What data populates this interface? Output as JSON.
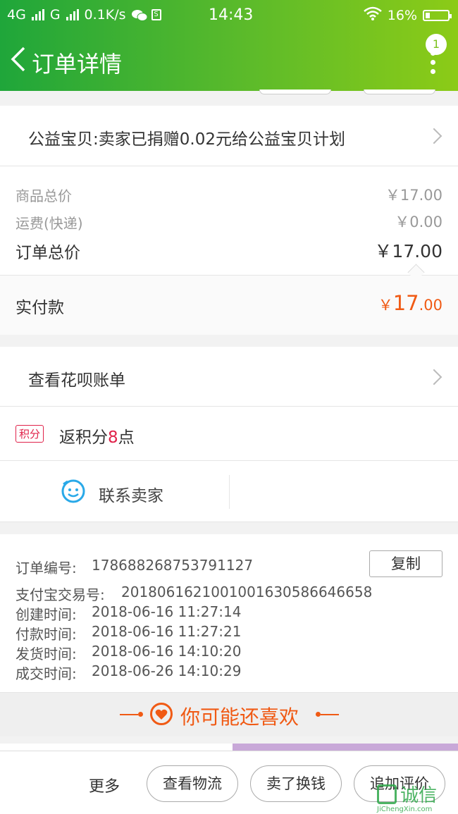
{
  "status_bar": {
    "network1": "4G",
    "network2": "G",
    "speed": "0.1K/s",
    "time": "14:43",
    "battery": "16%"
  },
  "nav": {
    "title": "订单详情",
    "badge": "1"
  },
  "charity": {
    "text": "公益宝贝:卖家已捐赠0.02元给公益宝贝计划"
  },
  "prices": {
    "goods_label": "商品总价",
    "goods_value": "￥17.00",
    "shipping_label": "运费(快递)",
    "shipping_value": "￥0.00",
    "total_label": "订单总价",
    "total_value": "￥17.00",
    "paid_label": "实付款",
    "paid_symbol": "￥",
    "paid_int": "17",
    "paid_dec": ".00"
  },
  "huabei": {
    "text": "查看花呗账单"
  },
  "points": {
    "tag": "积分",
    "prefix": "返积分",
    "num": "8",
    "suffix": "点"
  },
  "contact": {
    "label": "联系卖家"
  },
  "order_info": {
    "order_no_label": "订单编号:",
    "order_no": "178688268753791127",
    "copy_label": "复制",
    "alipay_label": "支付宝交易号:",
    "alipay_no": "2018061621001001630586646658",
    "created_label": "创建时间:",
    "created": "2018-06-16 11:27:14",
    "paid_label": "付款时间:",
    "paid": "2018-06-16 11:27:21",
    "shipped_label": "发货时间:",
    "shipped": "2018-06-16 14:10:20",
    "closed_label": "成交时间:",
    "closed": "2018-06-26 14:10:29"
  },
  "recommend": {
    "title": "你可能还喜欢"
  },
  "bottom_bar": {
    "more": "更多",
    "logistics": "查看物流",
    "resell": "卖了换钱",
    "review": "追加评价"
  },
  "watermark": {
    "text": "诚信",
    "url": "JiChengXin.com"
  },
  "colors": {
    "green_start": "#1fa63a",
    "green_end": "#8ccb17",
    "accent_orange": "#f05a14",
    "points_red": "#e0224a"
  }
}
